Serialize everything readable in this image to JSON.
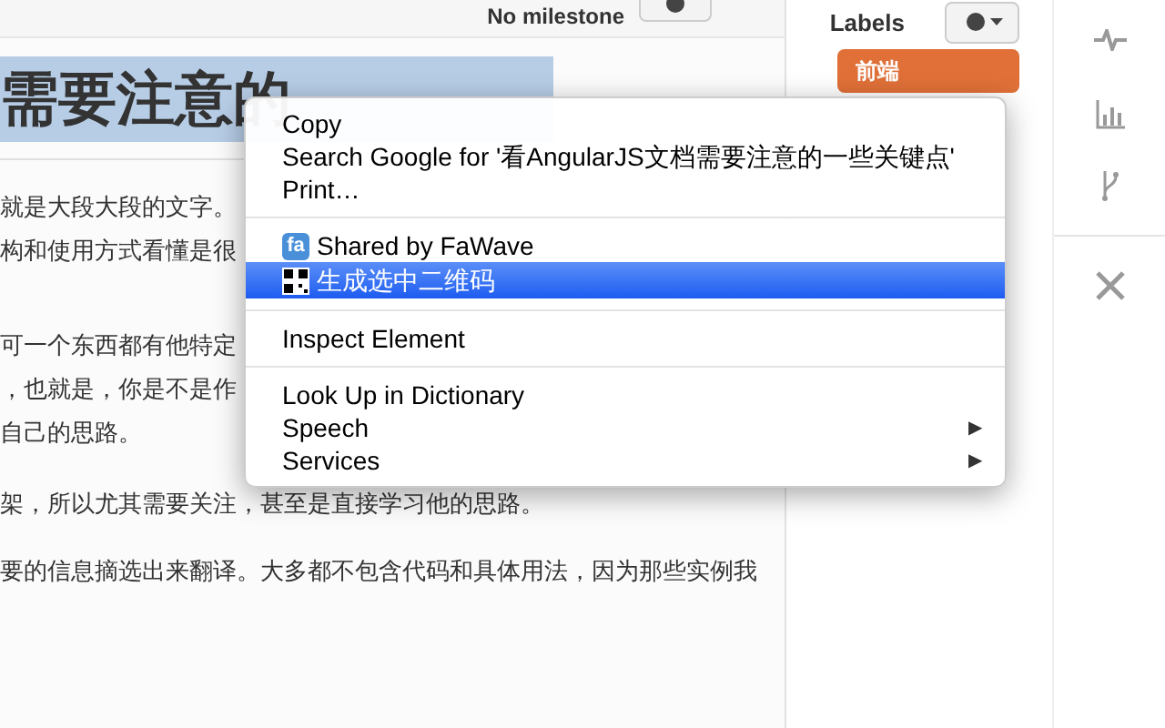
{
  "toolbar": {
    "milestone": "No milestone"
  },
  "article": {
    "heading": "需要注意的",
    "paragraphs": [
      [
        "就是大段大段的文字。",
        "构和使用方式看懂是很"
      ],
      [
        "可一个东西都有他特定",
        "，也就是，你是不是作",
        "自己的思路。"
      ],
      [
        "架，所以尤其需要关注，甚至是直接学习他的思路。"
      ],
      [
        "要的信息摘选出来翻译。大多都不包含代码和具体用法，因为那些实例我"
      ]
    ]
  },
  "sidebar": {
    "title": "Labels",
    "labels": [
      {
        "name": "前端",
        "color": "#e07038"
      }
    ]
  },
  "context_menu": [
    {
      "kind": "item",
      "label": "Copy",
      "selected": false
    },
    {
      "kind": "item",
      "label": "Search Google for '看AngularJS文档需要注意的一些关键点'",
      "selected": false
    },
    {
      "kind": "item",
      "label": "Print…",
      "selected": false
    },
    {
      "kind": "separator"
    },
    {
      "kind": "fawave",
      "label": "Shared by FaWave",
      "icon_text": "fa",
      "selected": false
    },
    {
      "kind": "qr",
      "label": "生成选中二维码",
      "selected": true
    },
    {
      "kind": "separator"
    },
    {
      "kind": "item",
      "label": "Inspect Element",
      "selected": false
    },
    {
      "kind": "separator"
    },
    {
      "kind": "item",
      "label": "Look Up in Dictionary",
      "selected": false
    },
    {
      "kind": "submenu",
      "label": "Speech",
      "arrow": "▶",
      "selected": false
    },
    {
      "kind": "submenu",
      "label": "Services",
      "arrow": "▶",
      "selected": false
    }
  ]
}
